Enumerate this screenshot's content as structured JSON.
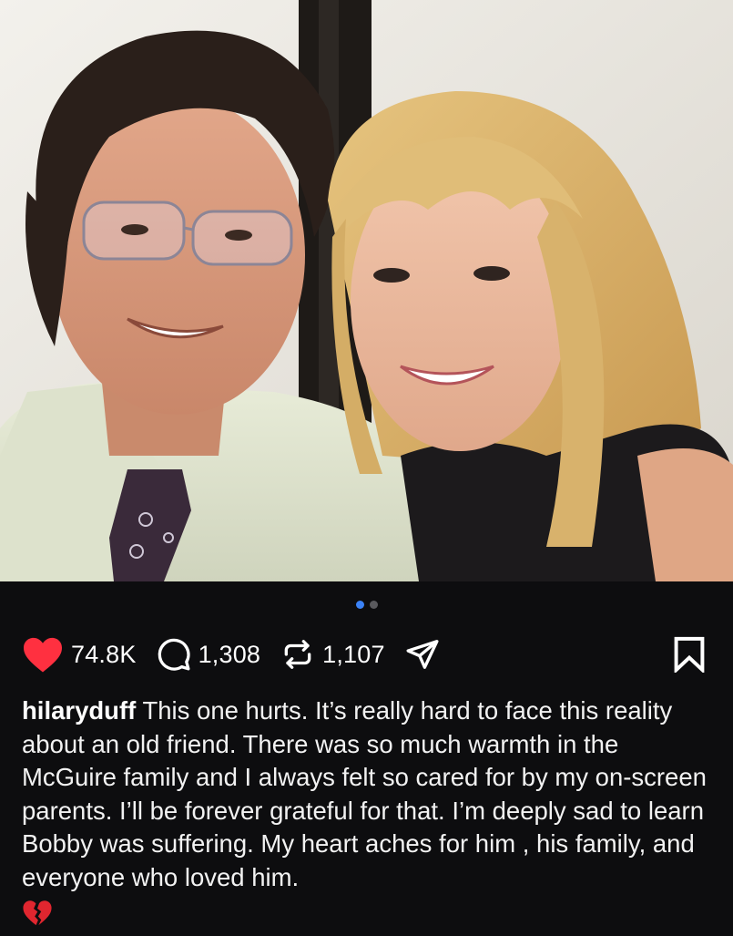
{
  "post": {
    "image_alt": "Photo of a smiling man with glasses in a tie next to a smiling young blonde woman",
    "carousel": {
      "total": 2,
      "active": 1
    },
    "stats": {
      "likes": "74.8K",
      "comments": "1,308",
      "reposts": "1,107"
    },
    "caption": {
      "username": "hilaryduff",
      "text": "This one hurts. It’s really hard to face this reality about an old friend. There was so much warmth in the McGuire family and I always felt so cared for by my on-screen parents. I’ll be forever grateful for that. I’m deeply sad to learn Bobby was suffering. My heart aches for him , his family, and everyone who loved him.",
      "emoji": "broken-heart-icon"
    }
  },
  "colors": {
    "background": "#0d0d0f",
    "like": "#ff3040",
    "carousel_active": "#3b82f6",
    "carousel_inactive": "#5a5a5e",
    "broken_heart": "#e0262f"
  }
}
